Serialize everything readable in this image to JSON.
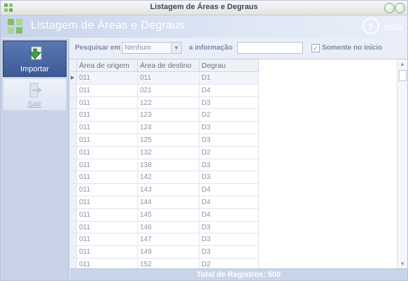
{
  "window": {
    "title": "Listagem de Áreas e Degraus"
  },
  "header": {
    "title": "Listagem de Áreas e Degraus",
    "help_label": "Ajuda"
  },
  "sidebar": {
    "import_label": "Importar",
    "exit_label": "Sair"
  },
  "search": {
    "search_in_label": "Pesquisar em",
    "field_value": "Nenhum",
    "info_label": "a informação",
    "info_value": "",
    "only_start_label": "Somente no início",
    "only_start_checked": true
  },
  "table": {
    "columns": [
      "Área de origem",
      "Área de destino",
      "Degrau"
    ],
    "rows": [
      [
        "011",
        "011",
        "D1"
      ],
      [
        "011",
        "021",
        "D4"
      ],
      [
        "011",
        "122",
        "D3"
      ],
      [
        "011",
        "123",
        "D2"
      ],
      [
        "011",
        "124",
        "D3"
      ],
      [
        "011",
        "125",
        "D3"
      ],
      [
        "011",
        "132",
        "D2"
      ],
      [
        "011",
        "138",
        "D3"
      ],
      [
        "011",
        "142",
        "D3"
      ],
      [
        "011",
        "143",
        "D4"
      ],
      [
        "011",
        "144",
        "D4"
      ],
      [
        "011",
        "145",
        "D4"
      ],
      [
        "011",
        "146",
        "D3"
      ],
      [
        "011",
        "147",
        "D3"
      ],
      [
        "011",
        "149",
        "D3"
      ],
      [
        "011",
        "152",
        "D2"
      ]
    ]
  },
  "footer": {
    "total_label": "Total de Registros: 500"
  },
  "colors": {
    "accent": "#3c5a96",
    "header_bg": "#c7d3ea",
    "sidebar_bg": "#c9d3e8"
  }
}
